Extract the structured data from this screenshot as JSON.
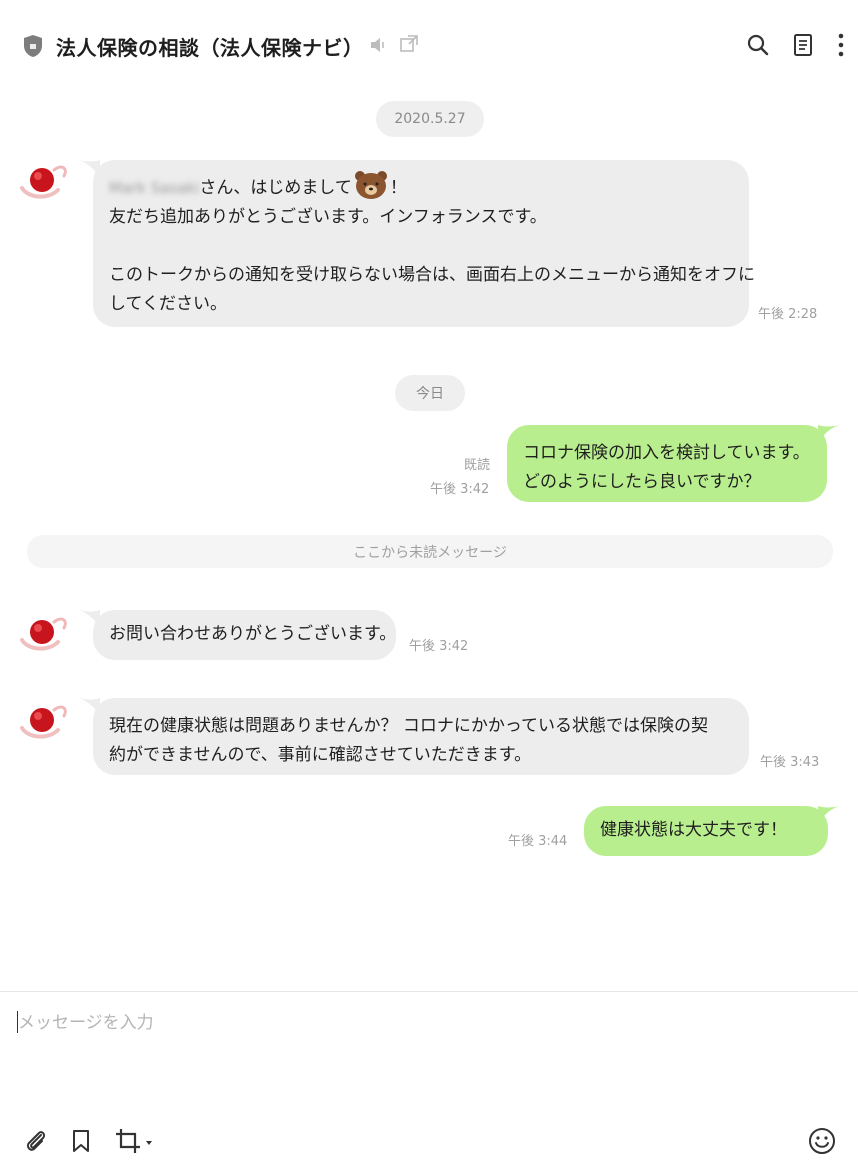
{
  "header": {
    "title": "法人保険の相談（法人保険ナビ）"
  },
  "date_separator": "2020.5.27",
  "today_separator": "今日",
  "unread_separator": "ここから未読メッセージ",
  "messages": [
    {
      "sender": "bot",
      "name_blurred": "Mark Sasaki",
      "line1_suffix": "さん、はじめまして",
      "line1_end": "！",
      "line2": "友だち追加ありがとうございます。インフォランスです。",
      "line3": "このトークからの通知を受け取らない場合は、画面右上のメニューから通知をオフに",
      "line4": "してください。",
      "time": "午後 2:28"
    },
    {
      "sender": "me",
      "line1": "コロナ保険の加入を検討しています。",
      "line2": "どのようにしたら良いですか？",
      "read": "既読",
      "time": "午後 3:42"
    },
    {
      "sender": "bot",
      "line1": "お問い合わせありがとうございます。",
      "time": "午後 3:42"
    },
    {
      "sender": "bot",
      "line1": "現在の健康状態は問題ありませんか？ コロナにかかっている状態では保険の契",
      "line2": "約ができませんので、事前に確認させていただきます。",
      "time": "午後 3:43"
    },
    {
      "sender": "me",
      "line1": "健康状態は大丈夫です！",
      "time": "午後 3:44"
    }
  ],
  "composer": {
    "placeholder": "メッセージを入力",
    "value": ""
  },
  "icons": {
    "header": [
      "shield-icon",
      "mute-icon",
      "popout-icon",
      "search-icon",
      "notes-icon",
      "more-icon"
    ],
    "toolbar": [
      "attach-icon",
      "bookmark-icon",
      "capture-icon",
      "emoji-icon"
    ]
  },
  "colors": {
    "incoming_bubble": "#ededed",
    "outgoing_bubble": "#b9ee8e",
    "meta_text": "#a0a0a0"
  }
}
